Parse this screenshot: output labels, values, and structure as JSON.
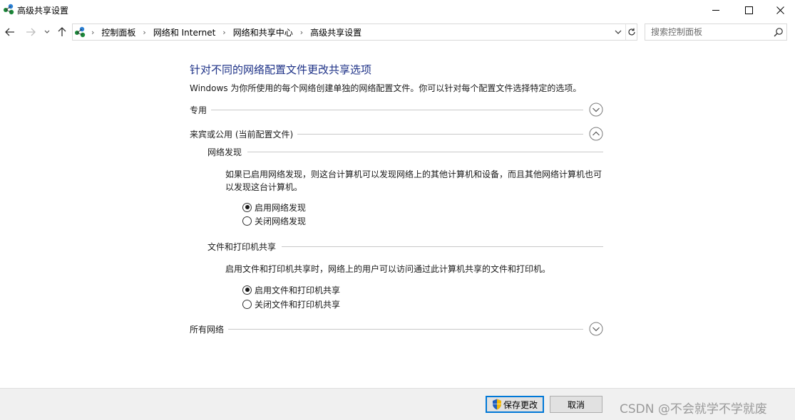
{
  "window": {
    "title": "高级共享设置",
    "app_icon": "network-center-icon"
  },
  "nav": {
    "breadcrumbs": [
      "控制面板",
      "网络和 Internet",
      "网络和共享中心",
      "高级共享设置"
    ],
    "search_placeholder": "搜索控制面板"
  },
  "content": {
    "heading": "针对不同的网络配置文件更改共享选项",
    "description": "Windows 为你所使用的每个网络创建单独的网络配置文件。你可以针对每个配置文件选择特定的选项。",
    "sections": {
      "private": {
        "label": "专用",
        "expanded": false
      },
      "guest_public": {
        "label": "来宾或公用 (当前配置文件)",
        "expanded": true,
        "network_discovery": {
          "label": "网络发现",
          "description": "如果已启用网络发现，则这台计算机可以发现网络上的其他计算机和设备，而且其他网络计算机也可以发现这台计算机。",
          "options": [
            {
              "label": "启用网络发现",
              "checked": true
            },
            {
              "label": "关闭网络发现",
              "checked": false
            }
          ]
        },
        "file_printer_sharing": {
          "label": "文件和打印机共享",
          "description": "启用文件和打印机共享时，网络上的用户可以访问通过此计算机共享的文件和打印机。",
          "options": [
            {
              "label": "启用文件和打印机共享",
              "checked": true
            },
            {
              "label": "关闭文件和打印机共享",
              "checked": false
            }
          ]
        }
      },
      "all_networks": {
        "label": "所有网络",
        "expanded": false
      }
    }
  },
  "footer": {
    "save_label": "保存更改",
    "cancel_label": "取消",
    "watermark": "CSDN @不会就学不学就废"
  },
  "colors": {
    "heading": "#1e3287",
    "accent": "#0078d7",
    "footer_bg": "#f0f0f0"
  }
}
